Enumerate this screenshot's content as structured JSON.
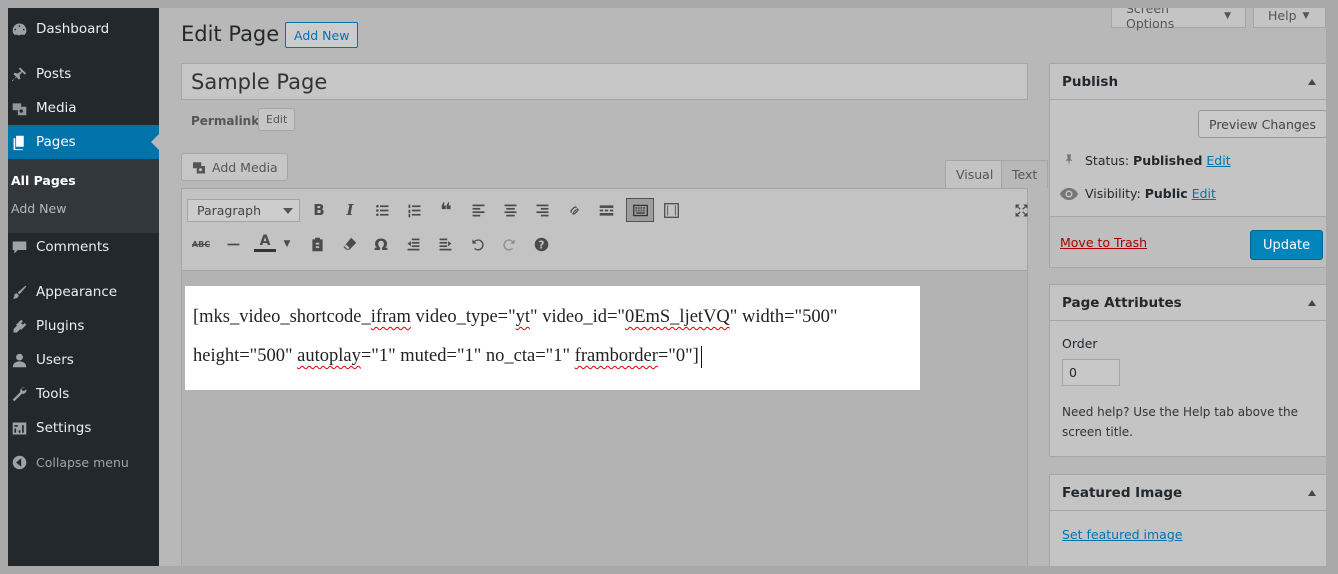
{
  "sidebar": {
    "items": [
      {
        "label": "Dashboard",
        "icon": "dashboard-icon"
      },
      {
        "label": "Posts",
        "icon": "pin-icon"
      },
      {
        "label": "Media",
        "icon": "media-icon"
      },
      {
        "label": "Pages",
        "icon": "pages-icon"
      },
      {
        "label": "Comments",
        "icon": "comment-icon"
      },
      {
        "label": "Appearance",
        "icon": "brush-icon"
      },
      {
        "label": "Plugins",
        "icon": "plugin-icon"
      },
      {
        "label": "Users",
        "icon": "user-icon"
      },
      {
        "label": "Tools",
        "icon": "wrench-icon"
      },
      {
        "label": "Settings",
        "icon": "settings-icon"
      }
    ],
    "sub": [
      "All Pages",
      "Add New"
    ],
    "collapse": "Collapse menu"
  },
  "top": {
    "screen_options": "Screen Options",
    "help": "Help"
  },
  "header": {
    "title": "Edit Page",
    "add_new": "Add New"
  },
  "post": {
    "title": "Sample Page",
    "permalink_label": "Permalink:",
    "edit_label": "Edit",
    "add_media": "Add Media",
    "tab_visual": "Visual",
    "tab_text": "Text",
    "format": "Paragraph",
    "content": {
      "p1": "[mks_video_shortcode_",
      "p2": "ifram",
      "p3": " video_type=\"",
      "p4": "yt",
      "p5": "\" video_id=\"",
      "p6": "0EmS_ljetVQ",
      "p7": "\" width=\"500\"",
      "p8": "height=\"500\" ",
      "p9": "autoplay",
      "p10": "=\"1\" muted=\"1\" no_cta=\"1\" ",
      "p11": "framborder",
      "p12": "=\"0\"]"
    }
  },
  "publish": {
    "title": "Publish",
    "preview": "Preview Changes",
    "status_label": "Status:",
    "status_value": "Published",
    "visibility_label": "Visibility:",
    "visibility_value": "Public",
    "edit": "Edit",
    "trash": "Move to Trash",
    "update": "Update"
  },
  "attributes": {
    "title": "Page Attributes",
    "order_label": "Order",
    "order_value": "0",
    "help": "Need help? Use the Help tab above the screen title."
  },
  "featured": {
    "title": "Featured Image",
    "link": "Set featured image"
  },
  "colors": {
    "accent": "#0073aa",
    "sidebar": "#23282d",
    "primary_button": "#0085ba"
  }
}
